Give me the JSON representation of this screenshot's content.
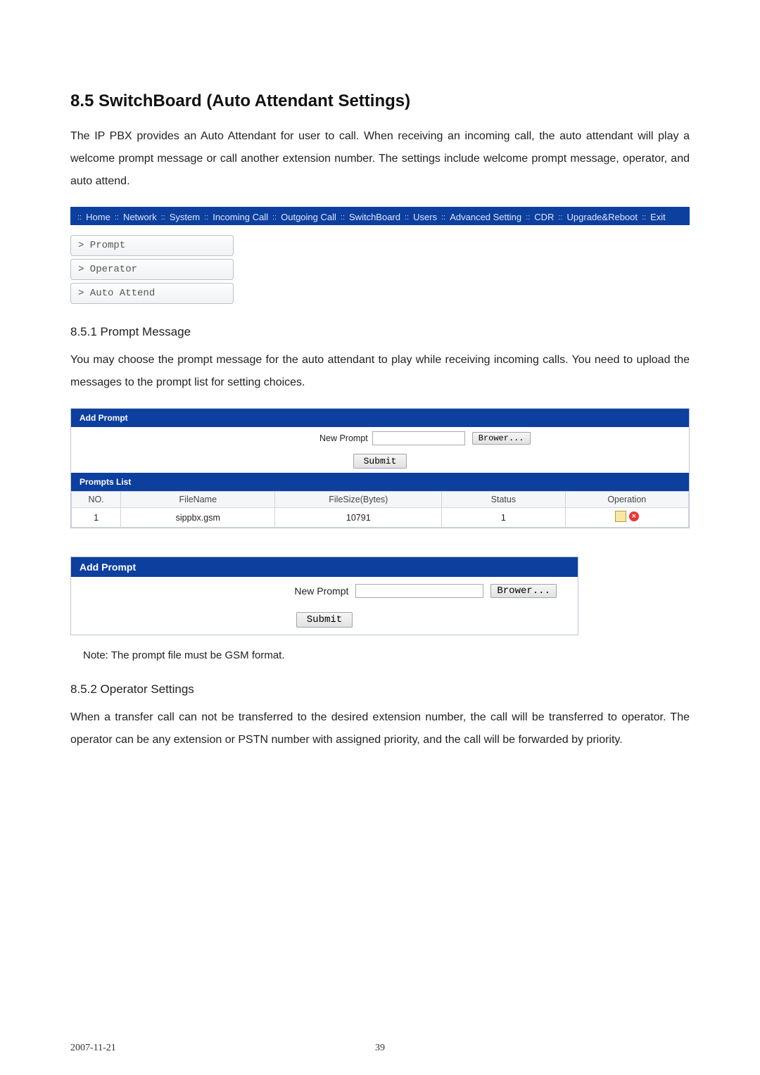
{
  "headings": {
    "h_8_5": "8.5 SwitchBoard (Auto Attendant Settings)",
    "h_8_5_1": "8.5.1 Prompt Message",
    "h_8_5_2": "8.5.2 Operator Settings"
  },
  "paragraphs": {
    "p_8_5": "The IP PBX provides an Auto Attendant for user to call.   When receiving an incoming call, the auto attendant will play a welcome prompt message or call another extension number.   The settings include welcome prompt message, operator, and auto attend.",
    "p_8_5_1": "You may choose the prompt message for the auto attendant to play while receiving incoming calls. You need to upload the messages to the prompt list for setting choices.",
    "note": "Note: The prompt file must be GSM format.",
    "p_8_5_2": "When a transfer call can not be transferred to the desired extension number, the call will be transferred to operator.   The operator can be any extension or PSTN number with assigned priority, and the call will be forwarded by priority."
  },
  "nav": {
    "items": [
      "Home",
      "Network",
      "System",
      "Incoming Call",
      "Outgoing Call",
      "SwitchBoard",
      "Users",
      "Advanced Setting",
      "CDR",
      "Upgrade&Reboot",
      "Exit"
    ]
  },
  "side_menu": {
    "prompt": "> Prompt",
    "operator": "> Operator",
    "auto_attend": "> Auto Attend"
  },
  "add_prompt": {
    "title": "Add Prompt",
    "new_prompt_label": "New Prompt",
    "browse_btn": "Brower...",
    "submit_btn": "Submit"
  },
  "prompts_list": {
    "title": "Prompts List",
    "headers": {
      "no": "NO.",
      "filename": "FileName",
      "filesize": "FileSize(Bytes)",
      "status": "Status",
      "operation": "Operation"
    },
    "rows": [
      {
        "no": "1",
        "filename": "sippbx.gsm",
        "filesize": "10791",
        "status": "1"
      }
    ]
  },
  "footer": {
    "date": "2007-11-21",
    "page": "39"
  }
}
